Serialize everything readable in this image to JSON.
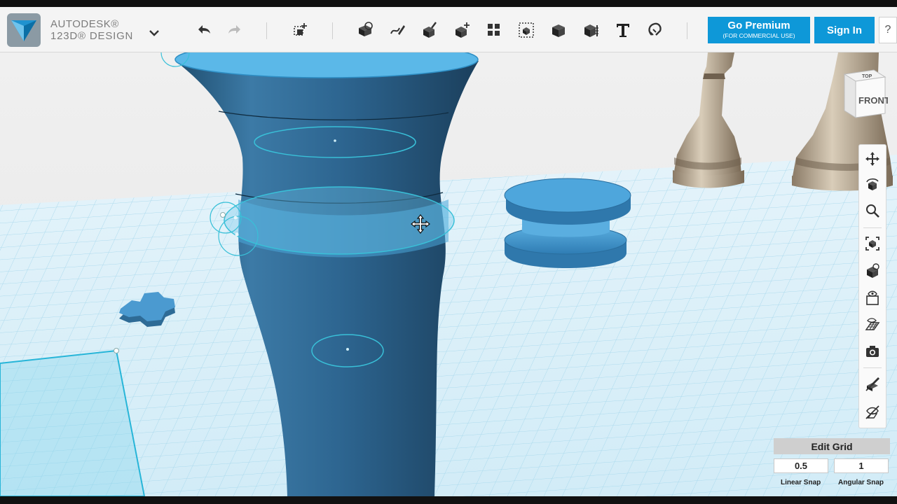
{
  "app": {
    "brand_line1": "AUTODESK®",
    "brand_line2": "123D® DESIGN"
  },
  "toolbar": {
    "icons": [
      "undo-icon",
      "redo-icon",
      "transform-icon",
      "primitives-icon",
      "sketch-icon",
      "construct-icon",
      "modify-icon",
      "pattern-icon",
      "group-icon",
      "combine-icon",
      "measure-icon",
      "text-icon",
      "snap-icon"
    ],
    "premium_label": "Go Premium",
    "premium_sub": "(FOR COMMERCIAL USE)",
    "signin_label": "Sign In",
    "help_label": "?"
  },
  "viewcube": {
    "top_label": "TOP",
    "front_label": "FRONT"
  },
  "sidebar": {
    "tools": [
      "pan-icon",
      "orbit-icon",
      "zoom-icon",
      "fit-icon",
      "view-mode-icon",
      "visibility-icon",
      "material-icon",
      "grid-icon",
      "screenshot-icon",
      "hide-sketch-icon",
      "hide-mesh-icon"
    ]
  },
  "grid_panel": {
    "title": "Edit Grid",
    "linear_snap_value": "0.5",
    "angular_snap_value": "1",
    "linear_snap_label": "Linear Snap",
    "angular_snap_label": "Angular Snap"
  },
  "colors": {
    "accent": "#0e98d8",
    "model_blue": "#3d8fc3",
    "grid_line": "#a8d8ec"
  }
}
